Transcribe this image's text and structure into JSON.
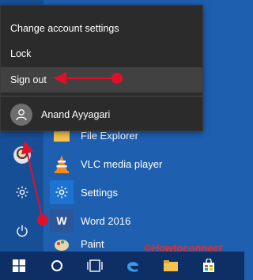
{
  "account_menu": {
    "items": [
      {
        "label": "Change account settings"
      },
      {
        "label": "Lock"
      },
      {
        "label": "Sign out"
      }
    ],
    "user_name": "Anand Ayyagari"
  },
  "apps": [
    {
      "label": "File Explorer",
      "icon": "folder-icon"
    },
    {
      "label": "VLC media player",
      "icon": "vlc-cone-icon"
    },
    {
      "label": "Settings",
      "icon": "gear-icon"
    },
    {
      "label": "Word 2016",
      "icon": "word-icon"
    },
    {
      "label": "Paint",
      "icon": "paint-icon"
    }
  ],
  "word_tile_letter": "W",
  "watermark": "©Howtoconnect",
  "colors": {
    "start_bg": "#1f5fb0",
    "flyout_bg": "#2b2b2b",
    "highlight": "#414141",
    "annotation": "#e0102a",
    "taskbar": "#0d2f66"
  }
}
